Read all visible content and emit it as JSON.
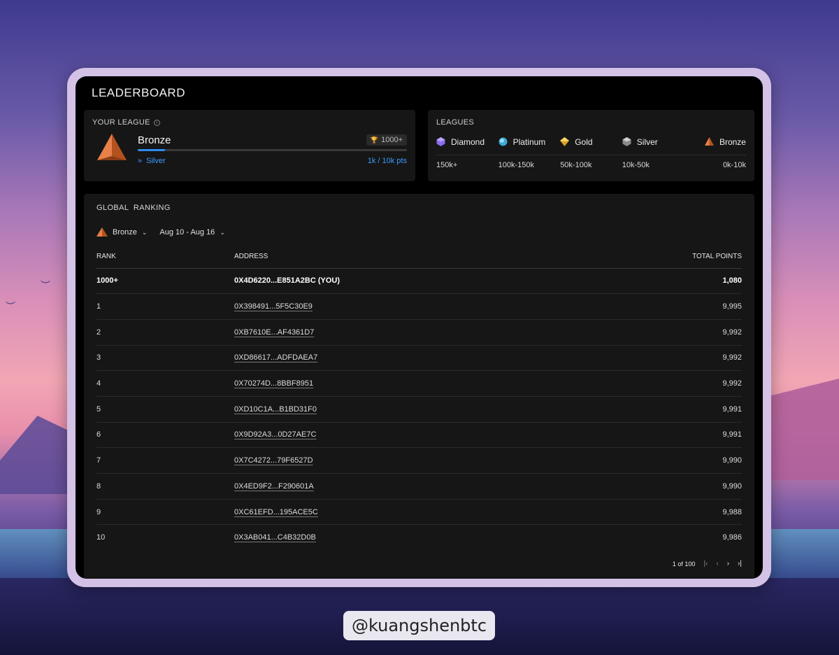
{
  "app": {
    "title": "LEADERBOARD"
  },
  "your_league": {
    "label": "YOUR LEAGUE",
    "league": "Bronze",
    "rank_badge": "1000+",
    "next_league": "Silver",
    "progress_text": "1k / 10k pts",
    "progress_fraction": 0.1
  },
  "leagues": {
    "label": "LEAGUES",
    "items": [
      {
        "name": "Diamond",
        "range": "150k+",
        "icon": "diamond-gem-icon",
        "color": "#8a6cf0"
      },
      {
        "name": "Platinum",
        "range": "100k-150k",
        "icon": "platinum-gem-icon",
        "color": "#5ec4e8"
      },
      {
        "name": "Gold",
        "range": "50k-100k",
        "icon": "gold-gem-icon",
        "color": "#e8b93a"
      },
      {
        "name": "Silver",
        "range": "10k-50k",
        "icon": "silver-gem-icon",
        "color": "#9a9a9a"
      },
      {
        "name": "Bronze",
        "range": "0k-10k",
        "icon": "bronze-pyramid-icon",
        "color": "#d46a32"
      }
    ]
  },
  "ranking": {
    "title": "GLOBAL  RANKING",
    "league_filter": "Bronze",
    "date_filter": "Aug 10 - Aug 16",
    "columns": {
      "rank": "RANK",
      "address": "ADDRESS",
      "points": "TOTAL POINTS"
    },
    "you": {
      "rank": "1000+",
      "address": "0X4D6220...E851A2BC (YOU)",
      "points": "1,080"
    },
    "rows": [
      {
        "rank": "1",
        "address": "0X398491...5F5C30E9",
        "points": "9,995"
      },
      {
        "rank": "2",
        "address": "0XB7610E...AF4361D7",
        "points": "9,992"
      },
      {
        "rank": "3",
        "address": "0XD86617...ADFDAEA7",
        "points": "9,992"
      },
      {
        "rank": "4",
        "address": "0X70274D...8BBF8951",
        "points": "9,992"
      },
      {
        "rank": "5",
        "address": "0XD10C1A...B1BD31F0",
        "points": "9,991"
      },
      {
        "rank": "6",
        "address": "0X9D92A3...0D27AE7C",
        "points": "9,991"
      },
      {
        "rank": "7",
        "address": "0X7C4272...79F6527D",
        "points": "9,990"
      },
      {
        "rank": "8",
        "address": "0X4ED9F2...F290601A",
        "points": "9,990"
      },
      {
        "rank": "9",
        "address": "0XC61EFD...195ACE5C",
        "points": "9,988"
      },
      {
        "rank": "10",
        "address": "0X3AB041...C4B32D0B",
        "points": "9,986"
      }
    ],
    "pagination": {
      "text": "1 of 100"
    }
  },
  "watermark": {
    "handle": "@kuangshenbtc"
  }
}
